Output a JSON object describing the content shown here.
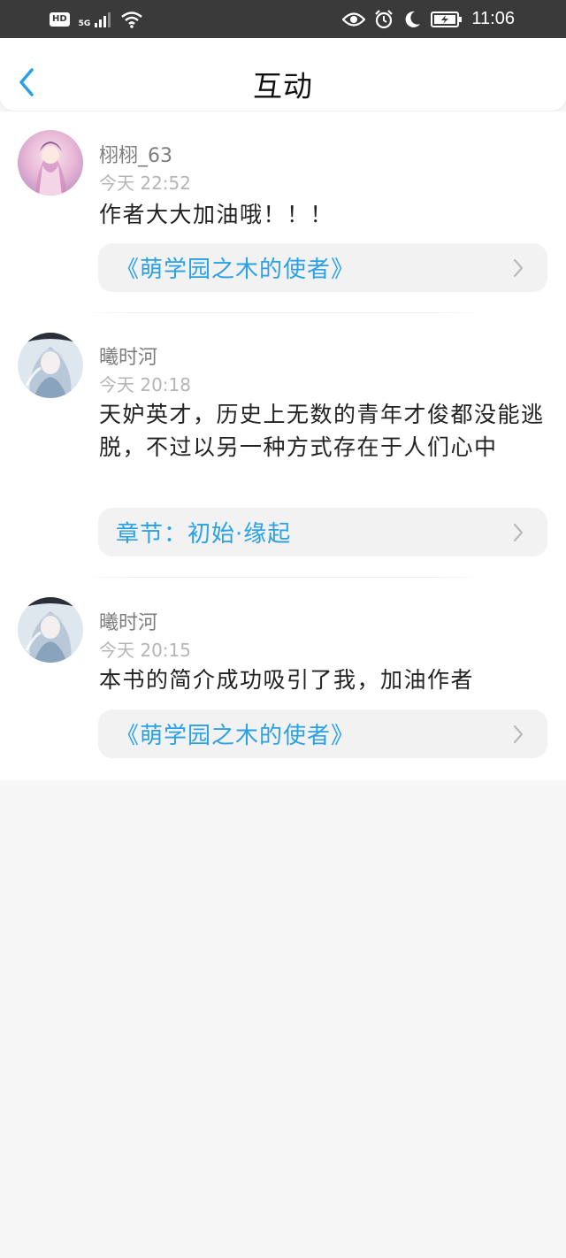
{
  "status_bar": {
    "hd": "HD",
    "network": "5G",
    "time": "11:06"
  },
  "header": {
    "title": "互动"
  },
  "colors": {
    "accent": "#2aa0e6",
    "status_bg": "#3a3a3a",
    "page_bg": "#f7f6f7"
  },
  "comments": [
    {
      "name": "栩栩_63",
      "time": "今天 22:52",
      "content": "作者大大加油哦！！！",
      "ref": "《萌学园之木的使者》"
    },
    {
      "name": "曦时河",
      "time": "今天 20:18",
      "content": "天妒英才，历史上无数的青年才俊都没能逃脱，不过以另一种方式存在于人们心中",
      "ref": "章节：初始·缘起"
    },
    {
      "name": "曦时河",
      "time": "今天 20:15",
      "content": "本书的简介成功吸引了我，加油作者",
      "ref": "《萌学园之木的使者》"
    }
  ]
}
